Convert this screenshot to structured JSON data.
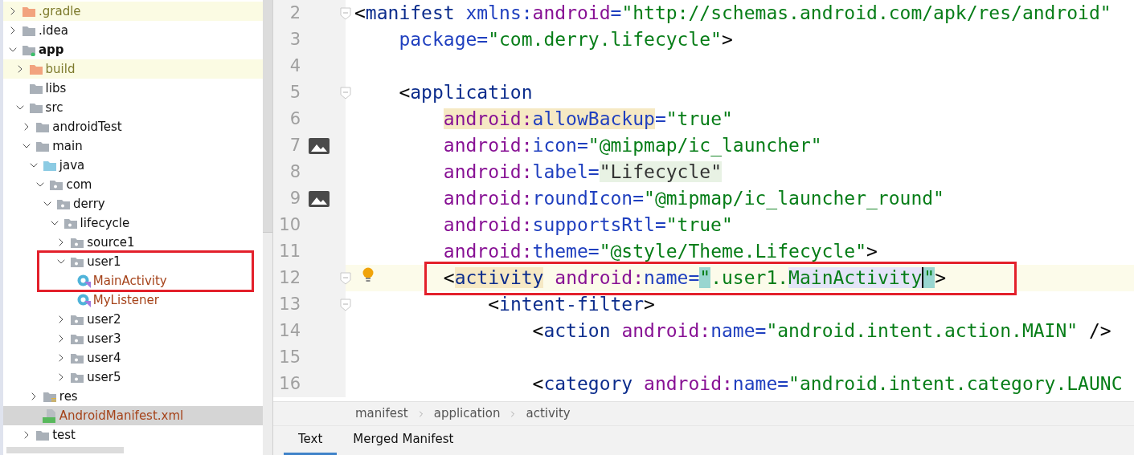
{
  "project_tree": {
    "items": [
      {
        "label": ".gradle",
        "kind": "excluded_folder",
        "excluded": true,
        "modified": false,
        "expanded": false,
        "selected": false
      },
      {
        "label": ".idea",
        "kind": "folder",
        "excluded": false,
        "modified": false,
        "expanded": false,
        "selected": false
      },
      {
        "label": "app",
        "kind": "module",
        "excluded": false,
        "modified": false,
        "expanded": true,
        "selected": false,
        "children": [
          {
            "label": "build",
            "kind": "excluded_folder",
            "excluded": true,
            "modified": false,
            "expanded": false,
            "selected": false
          },
          {
            "label": "libs",
            "kind": "folder",
            "excluded": false,
            "modified": false,
            "selected": false
          },
          {
            "label": "src",
            "kind": "folder",
            "excluded": false,
            "modified": false,
            "expanded": true,
            "selected": false,
            "children": [
              {
                "label": "androidTest",
                "kind": "folder",
                "excluded": false,
                "modified": false,
                "expanded": false,
                "selected": false
              },
              {
                "label": "main",
                "kind": "folder",
                "excluded": false,
                "modified": false,
                "expanded": true,
                "selected": false,
                "children": [
                  {
                    "label": "java",
                    "kind": "source_folder",
                    "excluded": false,
                    "modified": false,
                    "expanded": true,
                    "selected": false,
                    "children": [
                      {
                        "label": "com",
                        "kind": "package",
                        "excluded": false,
                        "modified": false,
                        "expanded": true,
                        "selected": false,
                        "children": [
                          {
                            "label": "derry",
                            "kind": "package",
                            "excluded": false,
                            "modified": false,
                            "expanded": true,
                            "selected": false,
                            "children": [
                              {
                                "label": "lifecycle",
                                "kind": "package",
                                "excluded": false,
                                "modified": false,
                                "expanded": true,
                                "selected": false,
                                "children": [
                                  {
                                    "label": "source1",
                                    "kind": "package",
                                    "excluded": false,
                                    "modified": false,
                                    "expanded": false,
                                    "selected": false
                                  },
                                  {
                                    "label": "user1",
                                    "kind": "package",
                                    "excluded": false,
                                    "modified": false,
                                    "expanded": true,
                                    "selected": false,
                                    "annotated": true,
                                    "children": [
                                      {
                                        "label": "MainActivity",
                                        "kind": "class",
                                        "excluded": false,
                                        "modified": true,
                                        "selected": false
                                      },
                                      {
                                        "label": "MyListener",
                                        "kind": "class",
                                        "excluded": false,
                                        "modified": true,
                                        "selected": false
                                      }
                                    ]
                                  },
                                  {
                                    "label": "user2",
                                    "kind": "package",
                                    "excluded": false,
                                    "modified": false,
                                    "expanded": false,
                                    "selected": false
                                  },
                                  {
                                    "label": "user3",
                                    "kind": "package",
                                    "excluded": false,
                                    "modified": false,
                                    "expanded": false,
                                    "selected": false
                                  },
                                  {
                                    "label": "user4",
                                    "kind": "package",
                                    "excluded": false,
                                    "modified": false,
                                    "expanded": false,
                                    "selected": false
                                  },
                                  {
                                    "label": "user5",
                                    "kind": "package",
                                    "excluded": false,
                                    "modified": false,
                                    "expanded": false,
                                    "selected": false
                                  }
                                ]
                              }
                            ]
                          }
                        ]
                      }
                    ]
                  },
                  {
                    "label": "res",
                    "kind": "res_folder",
                    "excluded": false,
                    "modified": false,
                    "expanded": false,
                    "selected": false
                  },
                  {
                    "label": "AndroidManifest.xml",
                    "kind": "manifest",
                    "excluded": false,
                    "modified": true,
                    "selected": true
                  }
                ]
              },
              {
                "label": "test",
                "kind": "folder",
                "excluded": false,
                "modified": false,
                "expanded": false,
                "selected": false
              }
            ]
          }
        ]
      }
    ]
  },
  "editor": {
    "lines": [
      {
        "number": "2",
        "fold": true,
        "tokens": [
          {
            "text": "<",
            "kind": "punct"
          },
          {
            "text": "manifest",
            "kind": "tag"
          },
          {
            "text": " xmlns:",
            "kind": "attr"
          },
          {
            "text": "android",
            "kind": "ns"
          },
          {
            "text": "=",
            "kind": "attr"
          },
          {
            "text": "\"http://schemas.android.com/apk/res/android\"",
            "kind": "str"
          }
        ]
      },
      {
        "number": "3",
        "fold": false,
        "tokens": [
          {
            "text": "    package=",
            "kind": "attr"
          },
          {
            "text": "\"com.derry.lifecycle\"",
            "kind": "str"
          },
          {
            "text": ">",
            "kind": "punct"
          }
        ]
      },
      {
        "number": "4",
        "fold": false
      },
      {
        "number": "5",
        "fold": true,
        "tokens": [
          {
            "text": "    <",
            "kind": "punct"
          },
          {
            "text": "application",
            "kind": "tag"
          }
        ]
      },
      {
        "number": "6",
        "fold": false,
        "tokens": [
          {
            "text": "        android:",
            "kind": "ns",
            "highlighted": true
          },
          {
            "text": "allowBackup",
            "kind": "attr",
            "highlighted": true
          },
          {
            "text": "=",
            "kind": "attr"
          },
          {
            "text": "\"true\"",
            "kind": "str"
          }
        ]
      },
      {
        "number": "7",
        "fold": false,
        "image_preview": true,
        "tokens": [
          {
            "text": "        android:",
            "kind": "ns"
          },
          {
            "text": "icon=",
            "kind": "attr"
          },
          {
            "text": "\"@mipmap/ic_launcher\"",
            "kind": "str"
          }
        ]
      },
      {
        "number": "8",
        "fold": false,
        "tokens": [
          {
            "text": "        android:",
            "kind": "ns"
          },
          {
            "text": "label=",
            "kind": "attr"
          },
          {
            "text": "\"Lifecycle\"",
            "kind": "plain",
            "folded": true
          }
        ]
      },
      {
        "number": "9",
        "fold": false,
        "image_preview": true,
        "tokens": [
          {
            "text": "        android:",
            "kind": "ns"
          },
          {
            "text": "roundIcon=",
            "kind": "attr"
          },
          {
            "text": "\"@mipmap/ic_launcher_round\"",
            "kind": "str"
          }
        ]
      },
      {
        "number": "10",
        "fold": false,
        "tokens": [
          {
            "text": "        android:",
            "kind": "ns"
          },
          {
            "text": "supportsRtl=",
            "kind": "attr"
          },
          {
            "text": "\"true\"",
            "kind": "str"
          }
        ]
      },
      {
        "number": "11",
        "fold": false,
        "tokens": [
          {
            "text": "        android:",
            "kind": "ns"
          },
          {
            "text": "theme=",
            "kind": "attr"
          },
          {
            "text": "\"@style/Theme.Lifecycle\"",
            "kind": "str"
          },
          {
            "text": ">",
            "kind": "punct"
          }
        ]
      },
      {
        "number": "12",
        "fold": true,
        "intention_bulb": true,
        "current": true,
        "annotated": true,
        "tokens": [
          {
            "text": "        <",
            "kind": "punct"
          },
          {
            "text": "activity",
            "kind": "tag",
            "highlighted": true
          },
          {
            "text": " android:",
            "kind": "ns"
          },
          {
            "text": "name=",
            "kind": "attr"
          },
          {
            "text": "\"",
            "kind": "str",
            "matched": true
          },
          {
            "text": ".user1.",
            "kind": "str"
          },
          {
            "text": "MainActivity",
            "kind": "str",
            "selected": true,
            "caret": true
          },
          {
            "text": "\"",
            "kind": "str",
            "matched": true
          },
          {
            "text": ">",
            "kind": "punct"
          }
        ]
      },
      {
        "number": "13",
        "fold": true,
        "tokens": [
          {
            "text": "            <",
            "kind": "punct"
          },
          {
            "text": "intent-filter",
            "kind": "tag"
          },
          {
            "text": ">",
            "kind": "punct"
          }
        ]
      },
      {
        "number": "14",
        "fold": false,
        "tokens": [
          {
            "text": "                <",
            "kind": "punct"
          },
          {
            "text": "action",
            "kind": "tag"
          },
          {
            "text": " android:",
            "kind": "ns"
          },
          {
            "text": "name=",
            "kind": "attr"
          },
          {
            "text": "\"android.intent.action.MAIN\"",
            "kind": "str"
          },
          {
            "text": " />",
            "kind": "punct"
          }
        ]
      },
      {
        "number": "15",
        "fold": false
      },
      {
        "number": "16",
        "fold": false,
        "tokens": [
          {
            "text": "                <",
            "kind": "punct"
          },
          {
            "text": "category",
            "kind": "tag"
          },
          {
            "text": " android:",
            "kind": "ns"
          },
          {
            "text": "name=",
            "kind": "attr"
          },
          {
            "text": "\"android.intent.category.LAUNC",
            "kind": "str"
          }
        ]
      }
    ],
    "breadcrumbs": [
      "manifest",
      "application",
      "activity"
    ],
    "tabs": [
      {
        "label": "Text",
        "selected": true
      },
      {
        "label": "Merged Manifest",
        "selected": false
      }
    ]
  }
}
